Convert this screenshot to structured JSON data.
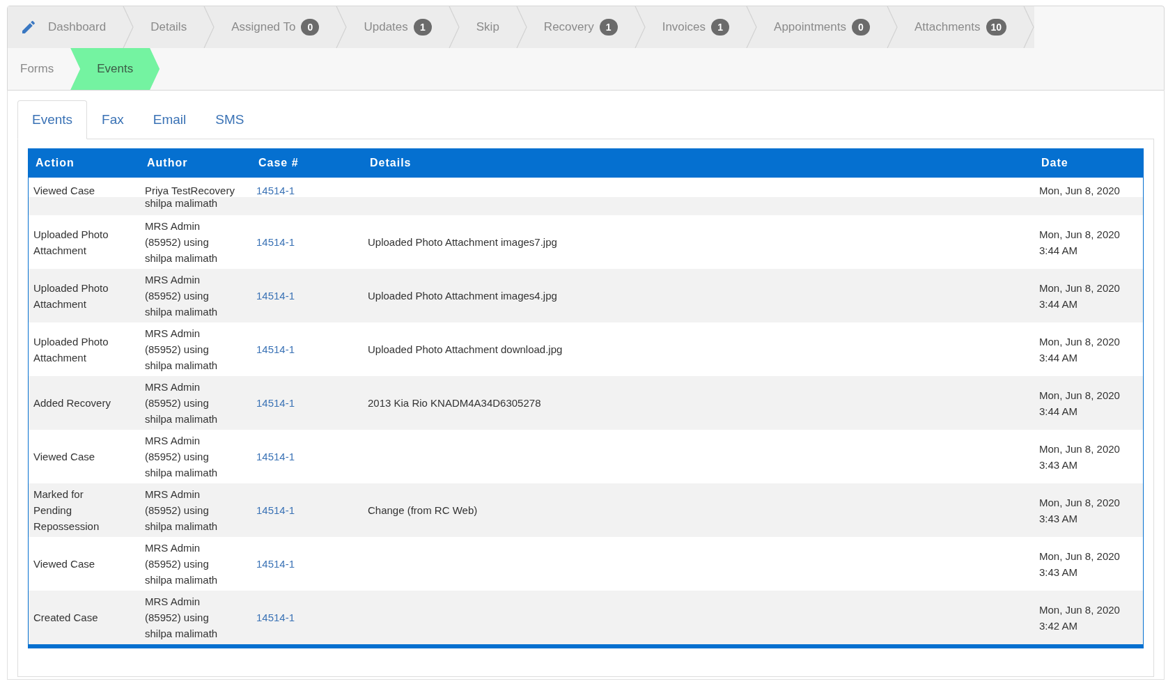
{
  "step_rows": [
    [
      {
        "label": "Dashboard",
        "selected": false
      },
      {
        "label": "Details",
        "selected": false
      },
      {
        "label": "Assigned To",
        "count": "0",
        "selected": false
      },
      {
        "label": "Updates",
        "count": "1",
        "selected": false
      },
      {
        "label": "Skip",
        "selected": false
      },
      {
        "label": "Recovery",
        "count": "1",
        "selected": false
      },
      {
        "label": "Invoices",
        "count": "1",
        "selected": false
      },
      {
        "label": "Appointments",
        "count": "0",
        "selected": false
      },
      {
        "label": "Attachments",
        "count": "10",
        "selected": false
      }
    ],
    [
      {
        "label": "Forms",
        "selected": false
      },
      {
        "label": "Events",
        "selected": true
      }
    ]
  ],
  "tabs": [
    {
      "label": "Events",
      "selected": true
    },
    {
      "label": "Fax",
      "selected": false
    },
    {
      "label": "Email",
      "selected": false
    },
    {
      "label": "SMS",
      "selected": false
    }
  ],
  "table": {
    "columns": [
      "Action",
      "Author",
      "Case #",
      "Details",
      "Date"
    ],
    "rows": [
      {
        "kind": "clipped",
        "action": "Viewed Case",
        "author": "Priya TestRecovery",
        "author_below": "shilpa malimath",
        "case_no": "14514-1",
        "date": "Mon, Jun 8, 2020"
      },
      {
        "kind": "full",
        "action": "Uploaded Photo Attachment",
        "author": "MRS Admin (85952) using shilpa malimath",
        "case_no": "14514-1",
        "details": "Uploaded Photo Attachment images7.jpg",
        "date": "Mon, Jun 8, 2020",
        "time": "3:44 AM"
      },
      {
        "kind": "full",
        "action": "Uploaded Photo Attachment",
        "author": "MRS Admin (85952) using shilpa malimath",
        "case_no": "14514-1",
        "details": "Uploaded Photo Attachment images4.jpg",
        "date": "Mon, Jun 8, 2020",
        "time": "3:44 AM"
      },
      {
        "kind": "full",
        "action": "Uploaded Photo Attachment",
        "author": "MRS Admin (85952) using shilpa malimath",
        "case_no": "14514-1",
        "details": "Uploaded Photo Attachment download.jpg",
        "date": "Mon, Jun 8, 2020",
        "time": "3:44 AM"
      },
      {
        "kind": "full",
        "action": "Added Recovery",
        "author": "MRS Admin (85952) using shilpa malimath",
        "case_no": "14514-1",
        "details": "2013 Kia Rio KNADM4A34D6305278",
        "date": "Mon, Jun 8, 2020",
        "time": "3:44 AM"
      },
      {
        "kind": "full",
        "action": "Viewed Case",
        "author": "MRS Admin (85952) using shilpa malimath",
        "case_no": "14514-1",
        "date": "Mon, Jun 8, 2020",
        "time": "3:43 AM"
      },
      {
        "kind": "full",
        "action": "Marked for Pending Repossession",
        "author": "MRS Admin (85952) using shilpa malimath",
        "case_no": "14514-1",
        "details": "Change (from RC Web)",
        "date": "Mon, Jun 8, 2020",
        "time": "3:43 AM"
      },
      {
        "kind": "full",
        "action": "Viewed Case",
        "author": "MRS Admin (85952) using shilpa malimath",
        "case_no": "14514-1",
        "date": "Mon, Jun 8, 2020",
        "time": "3:43 AM"
      },
      {
        "kind": "full",
        "action": "Created Case",
        "author": "MRS Admin (85952) using shilpa malimath",
        "case_no": "14514-1",
        "date": "Mon, Jun 8, 2020",
        "time": "3:42 AM"
      }
    ]
  }
}
